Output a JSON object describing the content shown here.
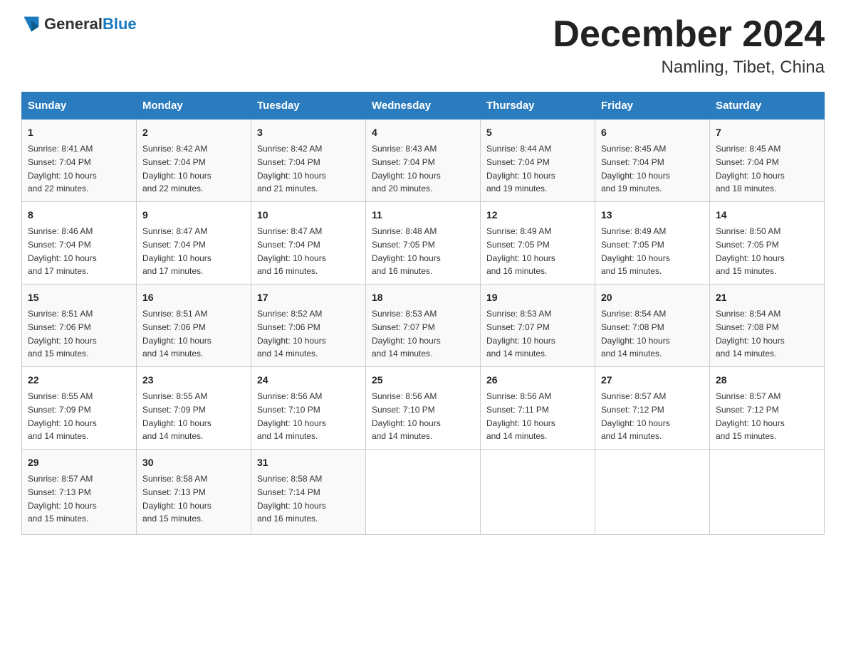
{
  "header": {
    "logo_general": "General",
    "logo_blue": "Blue",
    "month_title": "December 2024",
    "location": "Namling, Tibet, China"
  },
  "days_of_week": [
    "Sunday",
    "Monday",
    "Tuesday",
    "Wednesday",
    "Thursday",
    "Friday",
    "Saturday"
  ],
  "weeks": [
    [
      {
        "day": "1",
        "sunrise": "8:41 AM",
        "sunset": "7:04 PM",
        "daylight": "10 hours and 22 minutes."
      },
      {
        "day": "2",
        "sunrise": "8:42 AM",
        "sunset": "7:04 PM",
        "daylight": "10 hours and 22 minutes."
      },
      {
        "day": "3",
        "sunrise": "8:42 AM",
        "sunset": "7:04 PM",
        "daylight": "10 hours and 21 minutes."
      },
      {
        "day": "4",
        "sunrise": "8:43 AM",
        "sunset": "7:04 PM",
        "daylight": "10 hours and 20 minutes."
      },
      {
        "day": "5",
        "sunrise": "8:44 AM",
        "sunset": "7:04 PM",
        "daylight": "10 hours and 19 minutes."
      },
      {
        "day": "6",
        "sunrise": "8:45 AM",
        "sunset": "7:04 PM",
        "daylight": "10 hours and 19 minutes."
      },
      {
        "day": "7",
        "sunrise": "8:45 AM",
        "sunset": "7:04 PM",
        "daylight": "10 hours and 18 minutes."
      }
    ],
    [
      {
        "day": "8",
        "sunrise": "8:46 AM",
        "sunset": "7:04 PM",
        "daylight": "10 hours and 17 minutes."
      },
      {
        "day": "9",
        "sunrise": "8:47 AM",
        "sunset": "7:04 PM",
        "daylight": "10 hours and 17 minutes."
      },
      {
        "day": "10",
        "sunrise": "8:47 AM",
        "sunset": "7:04 PM",
        "daylight": "10 hours and 16 minutes."
      },
      {
        "day": "11",
        "sunrise": "8:48 AM",
        "sunset": "7:05 PM",
        "daylight": "10 hours and 16 minutes."
      },
      {
        "day": "12",
        "sunrise": "8:49 AM",
        "sunset": "7:05 PM",
        "daylight": "10 hours and 16 minutes."
      },
      {
        "day": "13",
        "sunrise": "8:49 AM",
        "sunset": "7:05 PM",
        "daylight": "10 hours and 15 minutes."
      },
      {
        "day": "14",
        "sunrise": "8:50 AM",
        "sunset": "7:05 PM",
        "daylight": "10 hours and 15 minutes."
      }
    ],
    [
      {
        "day": "15",
        "sunrise": "8:51 AM",
        "sunset": "7:06 PM",
        "daylight": "10 hours and 15 minutes."
      },
      {
        "day": "16",
        "sunrise": "8:51 AM",
        "sunset": "7:06 PM",
        "daylight": "10 hours and 14 minutes."
      },
      {
        "day": "17",
        "sunrise": "8:52 AM",
        "sunset": "7:06 PM",
        "daylight": "10 hours and 14 minutes."
      },
      {
        "day": "18",
        "sunrise": "8:53 AM",
        "sunset": "7:07 PM",
        "daylight": "10 hours and 14 minutes."
      },
      {
        "day": "19",
        "sunrise": "8:53 AM",
        "sunset": "7:07 PM",
        "daylight": "10 hours and 14 minutes."
      },
      {
        "day": "20",
        "sunrise": "8:54 AM",
        "sunset": "7:08 PM",
        "daylight": "10 hours and 14 minutes."
      },
      {
        "day": "21",
        "sunrise": "8:54 AM",
        "sunset": "7:08 PM",
        "daylight": "10 hours and 14 minutes."
      }
    ],
    [
      {
        "day": "22",
        "sunrise": "8:55 AM",
        "sunset": "7:09 PM",
        "daylight": "10 hours and 14 minutes."
      },
      {
        "day": "23",
        "sunrise": "8:55 AM",
        "sunset": "7:09 PM",
        "daylight": "10 hours and 14 minutes."
      },
      {
        "day": "24",
        "sunrise": "8:56 AM",
        "sunset": "7:10 PM",
        "daylight": "10 hours and 14 minutes."
      },
      {
        "day": "25",
        "sunrise": "8:56 AM",
        "sunset": "7:10 PM",
        "daylight": "10 hours and 14 minutes."
      },
      {
        "day": "26",
        "sunrise": "8:56 AM",
        "sunset": "7:11 PM",
        "daylight": "10 hours and 14 minutes."
      },
      {
        "day": "27",
        "sunrise": "8:57 AM",
        "sunset": "7:12 PM",
        "daylight": "10 hours and 14 minutes."
      },
      {
        "day": "28",
        "sunrise": "8:57 AM",
        "sunset": "7:12 PM",
        "daylight": "10 hours and 15 minutes."
      }
    ],
    [
      {
        "day": "29",
        "sunrise": "8:57 AM",
        "sunset": "7:13 PM",
        "daylight": "10 hours and 15 minutes."
      },
      {
        "day": "30",
        "sunrise": "8:58 AM",
        "sunset": "7:13 PM",
        "daylight": "10 hours and 15 minutes."
      },
      {
        "day": "31",
        "sunrise": "8:58 AM",
        "sunset": "7:14 PM",
        "daylight": "10 hours and 16 minutes."
      },
      null,
      null,
      null,
      null
    ]
  ]
}
